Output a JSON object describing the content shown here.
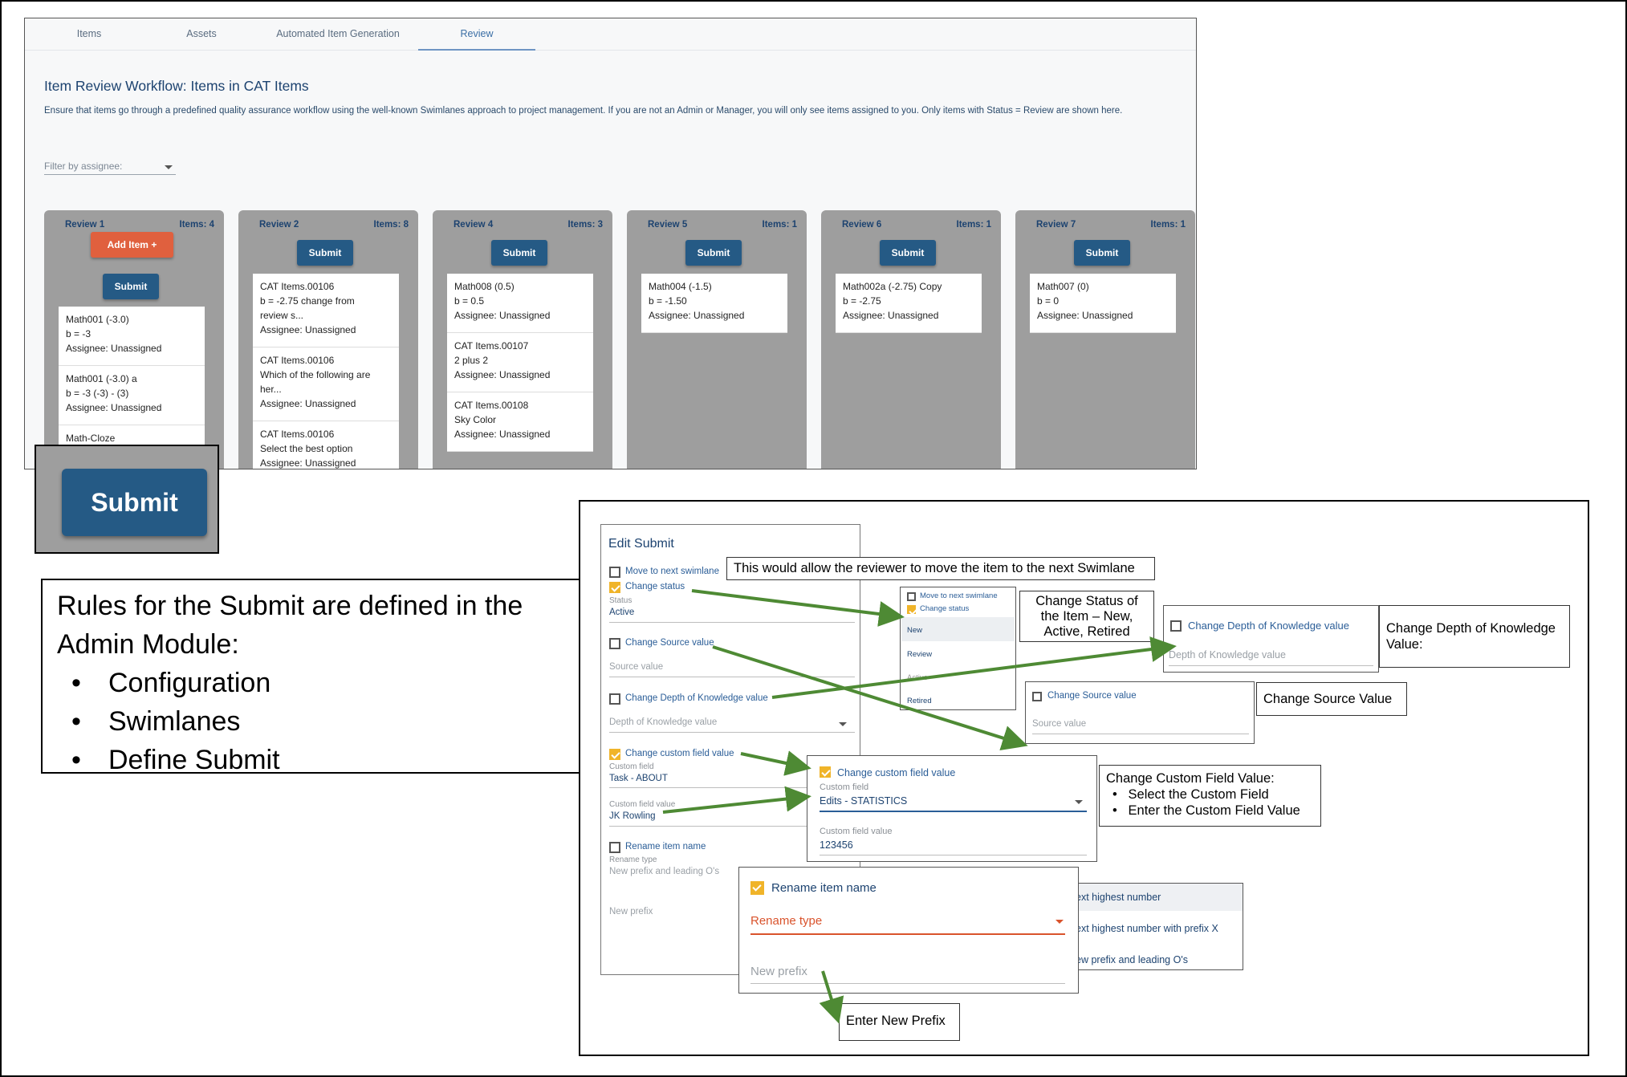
{
  "tabs": [
    {
      "label": "Items"
    },
    {
      "label": "Assets"
    },
    {
      "label": "Automated Item Generation"
    },
    {
      "label": "Review"
    }
  ],
  "workflow": {
    "title": "Item Review Workflow: Items in CAT Items",
    "description": "Ensure that items go through a predefined quality assurance workflow using the well-known Swimlanes approach to project management. If you are not an Admin or Manager, you will only see items assigned to you. Only items with Status = Review are shown here.",
    "filter_placeholder": "Filter by assignee:"
  },
  "lanes": [
    {
      "name": "Review 1",
      "count": "Items: 4",
      "add_label": "Add Item",
      "submit": "Submit",
      "cards": [
        {
          "l1": "Math001 (-3.0)",
          "l2": "b = -3",
          "l3": "Assignee: Unassigned",
          "l4": ""
        },
        {
          "l1": "Math001 (-3.0) a",
          "l2": "b = -3 (-3) - (3)",
          "l3": "Assignee: Unassigned",
          "l4": ""
        },
        {
          "l1": "Math-Cloze",
          "l2": "",
          "l3": "",
          "l4": ""
        }
      ]
    },
    {
      "name": "Review 2",
      "count": "Items: 8",
      "submit": "Submit",
      "cards": [
        {
          "l1": "CAT Items.00106",
          "l2": "b = -2.75 change from",
          "l3": "review s...",
          "l4": "Assignee: Unassigned"
        },
        {
          "l1": "CAT Items.00106",
          "l2": "Which of the following are",
          "l3": "her...",
          "l4": "Assignee: Unassigned"
        },
        {
          "l1": "CAT Items.00106",
          "l2": "Select the best option",
          "l3": "Assignee: Unassigned",
          "l4": ""
        }
      ]
    },
    {
      "name": "Review 4",
      "count": "Items: 3",
      "submit": "Submit",
      "cards": [
        {
          "l1": "Math008 (0.5)",
          "l2": "b = 0.5",
          "l3": "Assignee: Unassigned",
          "l4": ""
        },
        {
          "l1": "CAT Items.00107",
          "l2": "2 plus 2",
          "l3": "Assignee: Unassigned",
          "l4": ""
        },
        {
          "l1": "CAT Items.00108",
          "l2": "Sky Color",
          "l3": "Assignee: Unassigned",
          "l4": ""
        }
      ]
    },
    {
      "name": "Review 5",
      "count": "Items: 1",
      "submit": "Submit",
      "cards": [
        {
          "l1": "Math004 (-1.5)",
          "l2": "b = -1.50",
          "l3": "Assignee: Unassigned",
          "l4": ""
        }
      ]
    },
    {
      "name": "Review 6",
      "count": "Items: 1",
      "submit": "Submit",
      "cards": [
        {
          "l1": "Math002a (-2.75) Copy",
          "l2": "b = -2.75",
          "l3": "Assignee: Unassigned",
          "l4": ""
        }
      ]
    },
    {
      "name": "Review 7",
      "count": "Items: 1",
      "submit": "Submit",
      "cards": [
        {
          "l1": "Math007 (0)",
          "l2": "b = 0",
          "l3": "Assignee: Unassigned",
          "l4": ""
        }
      ]
    }
  ],
  "big_submit": "Submit",
  "rules": {
    "heading": "Rules for the Submit are defined in the Admin Module:",
    "items": [
      "Configuration",
      "Swimlanes",
      "Define Submit"
    ]
  },
  "edit_submit": {
    "title": "Edit Submit",
    "move_next": "Move to next swimlane",
    "change_status": "Change status",
    "status_sub": "Status",
    "status_val": "Active",
    "change_source": "Change Source value",
    "source_ph": "Source value",
    "change_dok": "Change Depth of Knowledge value",
    "dok_ph": "Depth of Knowledge value",
    "change_custom": "Change custom field value",
    "custom_sub": "Custom field",
    "custom_val": "Task - ABOUT",
    "custom_value_sub": "Custom field value",
    "custom_value_val": "JK Rowling",
    "rename": "Rename item name",
    "rename_sub": "Rename type",
    "rename_ph": "New prefix and leading O's",
    "new_prefix_ph": "New prefix"
  },
  "status_popup": {
    "move": "Move to next swimlane",
    "change": "Change status",
    "options": [
      "New",
      "Review",
      "Active",
      "Retired"
    ]
  },
  "dok_popup": {
    "label": "Change Depth of Knowledge value",
    "ph": "Depth of Knowledge value"
  },
  "source_popup": {
    "label": "Change Source value",
    "ph": "Source value"
  },
  "custom_popup": {
    "label": "Change custom field value",
    "field_sub": "Custom field",
    "field_val": "Edits - STATISTICS",
    "value_sub": "Custom field value",
    "value_val": "123456"
  },
  "rename_popup": {
    "label": "Rename item name",
    "type": "Rename type",
    "prefix": "New prefix",
    "options": [
      "ext highest number",
      "ext highest number with prefix X",
      "ew prefix and leading O's"
    ]
  },
  "callouts": {
    "swimlane": "This would allow the reviewer to move the item to the next Swimlane",
    "status": "Change Status of the Item – New, Active, Retired",
    "dok": "Change Depth of Knowledge Value:",
    "source": "Change Source Value",
    "custom_title": "Change Custom Field Value:",
    "custom_items": [
      "Select the Custom Field",
      "Enter the Custom Field Value"
    ],
    "prefix": "Enter New Prefix"
  },
  "colors": {
    "primary": "#255a85",
    "add": "#e0603e",
    "lane": "#9e9e9e",
    "arrow": "#4e8a34",
    "check": "#f0b429"
  }
}
